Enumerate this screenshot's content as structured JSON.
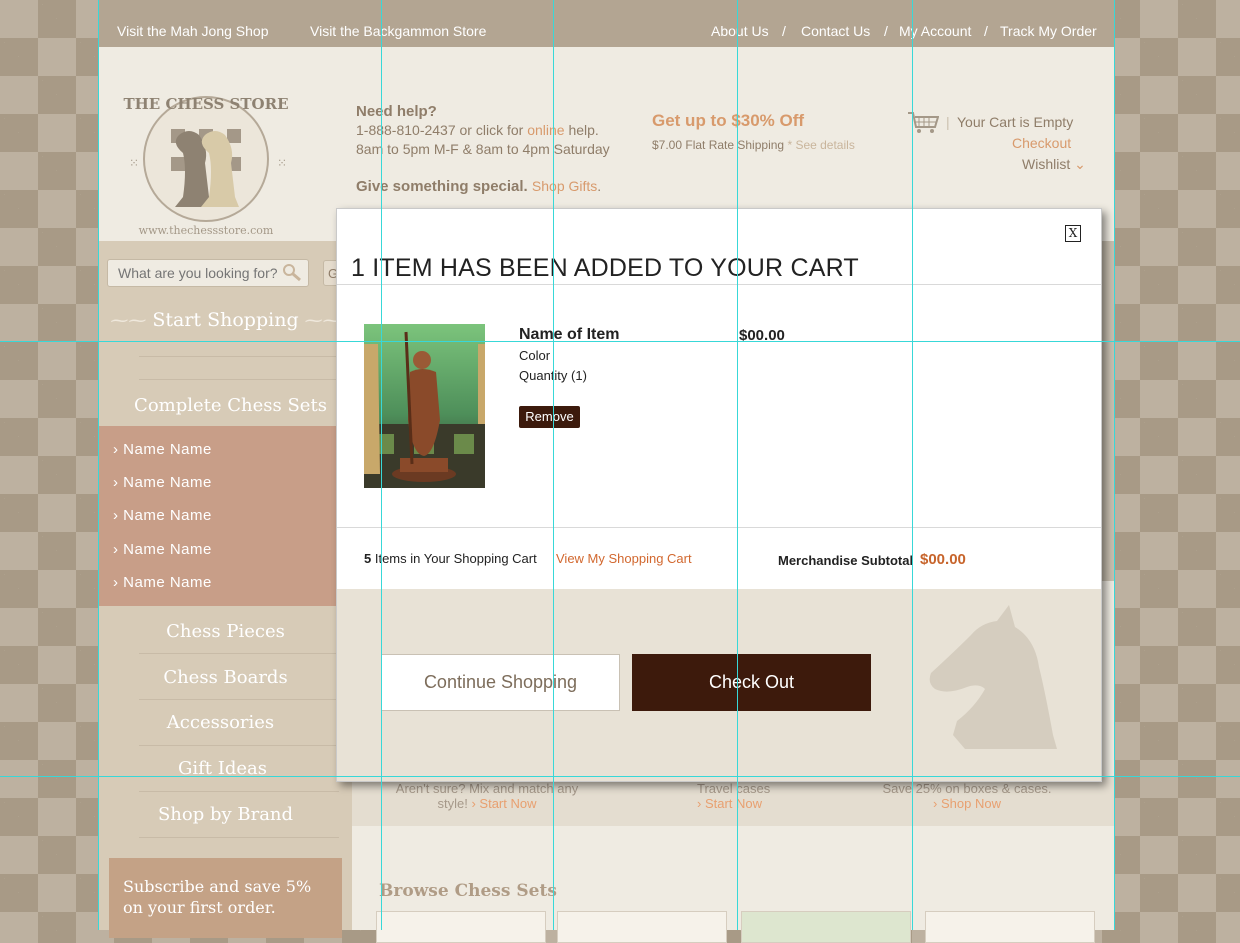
{
  "topbar": {
    "link1": "Visit the Mah Jong Shop",
    "link2": "Visit the Backgammon Store",
    "about": "About Us",
    "contact": "Contact Us",
    "account": "My Account",
    "track": "Track My Order",
    "sep": "/"
  },
  "logo": {
    "line1": "THE CHESS STORE",
    "line2": "www.thechessstore.com"
  },
  "help": {
    "title": "Need help?",
    "phone_prefix": "1-888-810-2437 or click for ",
    "online": "online",
    "phone_suffix": " help.",
    "hours": "8am to 5pm M-F & 8am to 4pm Saturday",
    "gift_prefix": "Give something special. ",
    "gift_link": "Shop Gifts",
    "gift_suffix": "."
  },
  "promo": {
    "headline": "Get up to $30% Off",
    "shipping": "$7.00 Flat Rate Shipping",
    "details": "* See details"
  },
  "cart": {
    "empty": "Your Cart is Empty",
    "pipe": "|",
    "checkout": "Checkout",
    "wishlist": "Wishlist"
  },
  "search": {
    "placeholder": "What are you looking for?",
    "go": "GO"
  },
  "sidebar": {
    "start": "Start Shopping",
    "complete_sets": "Complete Chess Sets",
    "sub_items": [
      "Name Name",
      "Name Name",
      "Name Name",
      "Name Name",
      "Name Name"
    ],
    "categories": [
      "Chess Pieces",
      "Chess Boards",
      "Accessories",
      "Gift Ideas",
      "Shop by Brand"
    ],
    "subscribe_line1": "Subscribe and save 5%",
    "subscribe_line2": "on your first order."
  },
  "promostrip": {
    "col1_line1": "Aren't sure? Mix and match any",
    "col1_line2": "style!",
    "col1_link": "Start Now",
    "col2_line1": "Travel cases",
    "col2_link": "Start Now",
    "col3_line1": "Save 25% on boxes & cases.",
    "col3_link": "Shop Now"
  },
  "browse": {
    "heading": "Browse Chess Sets"
  },
  "modal": {
    "close": "X",
    "title": "1 ITEM HAS BEEN ADDED TO YOUR CART",
    "item_name": "Name of Item",
    "item_color": "Color",
    "item_quantity": "Quantity (1)",
    "remove": "Remove",
    "item_price": "$00.00",
    "cart_count": "5",
    "cart_count_suffix": " Items in Your Shopping Cart",
    "view_cart": "View My Shopping Cart",
    "subtotal_label": "Merchandise Subtotal",
    "subtotal_value": "$00.00",
    "continue": "Continue Shopping",
    "checkout": "Check Out"
  },
  "colors": {
    "brand_brown": "#3d1a0c",
    "accent_orange": "#d2682f",
    "guide_cyan": "#38d8d8"
  },
  "icons": [
    "cart-icon",
    "search-icon",
    "chevron-down-icon",
    "chevron-right-icon",
    "close-icon",
    "knight-icon"
  ]
}
